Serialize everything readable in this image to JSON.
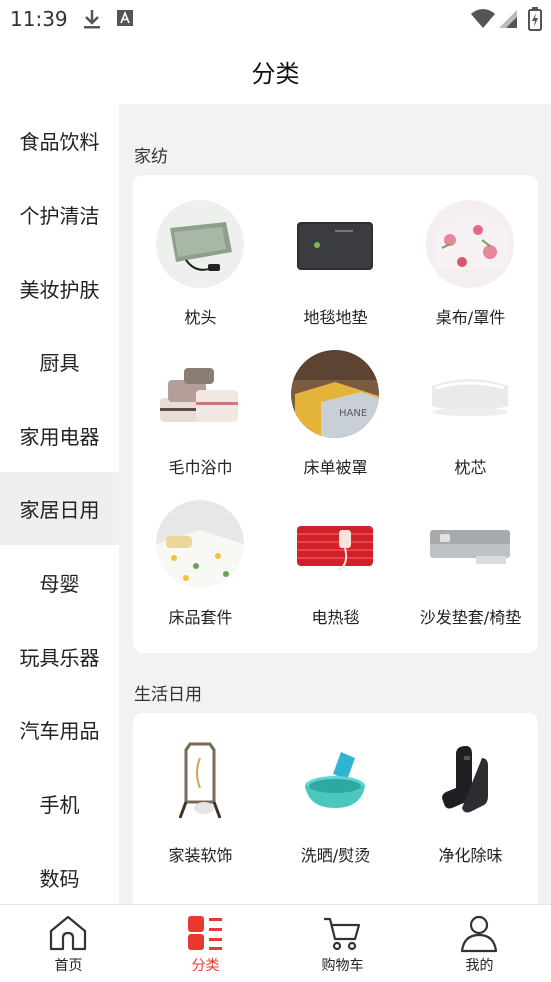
{
  "status_bar": {
    "time": "11:39",
    "icons": [
      "download-icon",
      "a-notification-icon",
      "wifi-icon",
      "signal-icon",
      "battery-charging-icon"
    ]
  },
  "header": {
    "title": "分类"
  },
  "sidebar": {
    "items": [
      {
        "label": "食品饮料"
      },
      {
        "label": "个护清洁"
      },
      {
        "label": "美妆护肤"
      },
      {
        "label": "厨具"
      },
      {
        "label": "家用电器"
      },
      {
        "label": "家居日用",
        "active": true
      },
      {
        "label": "母婴"
      },
      {
        "label": "玩具乐器"
      },
      {
        "label": "汽车用品"
      },
      {
        "label": "手机"
      },
      {
        "label": "数码"
      }
    ]
  },
  "sections": [
    {
      "title": "家纺",
      "items": [
        {
          "label": "枕头"
        },
        {
          "label": "地毯地垫"
        },
        {
          "label": "桌布/罩件"
        },
        {
          "label": "毛巾浴巾"
        },
        {
          "label": "床单被罩"
        },
        {
          "label": "枕芯"
        },
        {
          "label": "床品套件"
        },
        {
          "label": "电热毯"
        },
        {
          "label": "沙发垫套/椅垫"
        }
      ]
    },
    {
      "title": "生活日用",
      "items": [
        {
          "label": "家装软饰"
        },
        {
          "label": "洗晒/熨烫"
        },
        {
          "label": "净化除味"
        }
      ]
    }
  ],
  "tabbar": {
    "tabs": [
      {
        "label": "首页",
        "icon": "home-icon"
      },
      {
        "label": "分类",
        "icon": "category-icon",
        "active": true
      },
      {
        "label": "购物车",
        "icon": "cart-icon"
      },
      {
        "label": "我的",
        "icon": "user-icon"
      }
    ]
  },
  "colors": {
    "accent": "#e8382f",
    "sidebar_active_bg": "#efefef",
    "content_bg": "#f2f2f2"
  }
}
